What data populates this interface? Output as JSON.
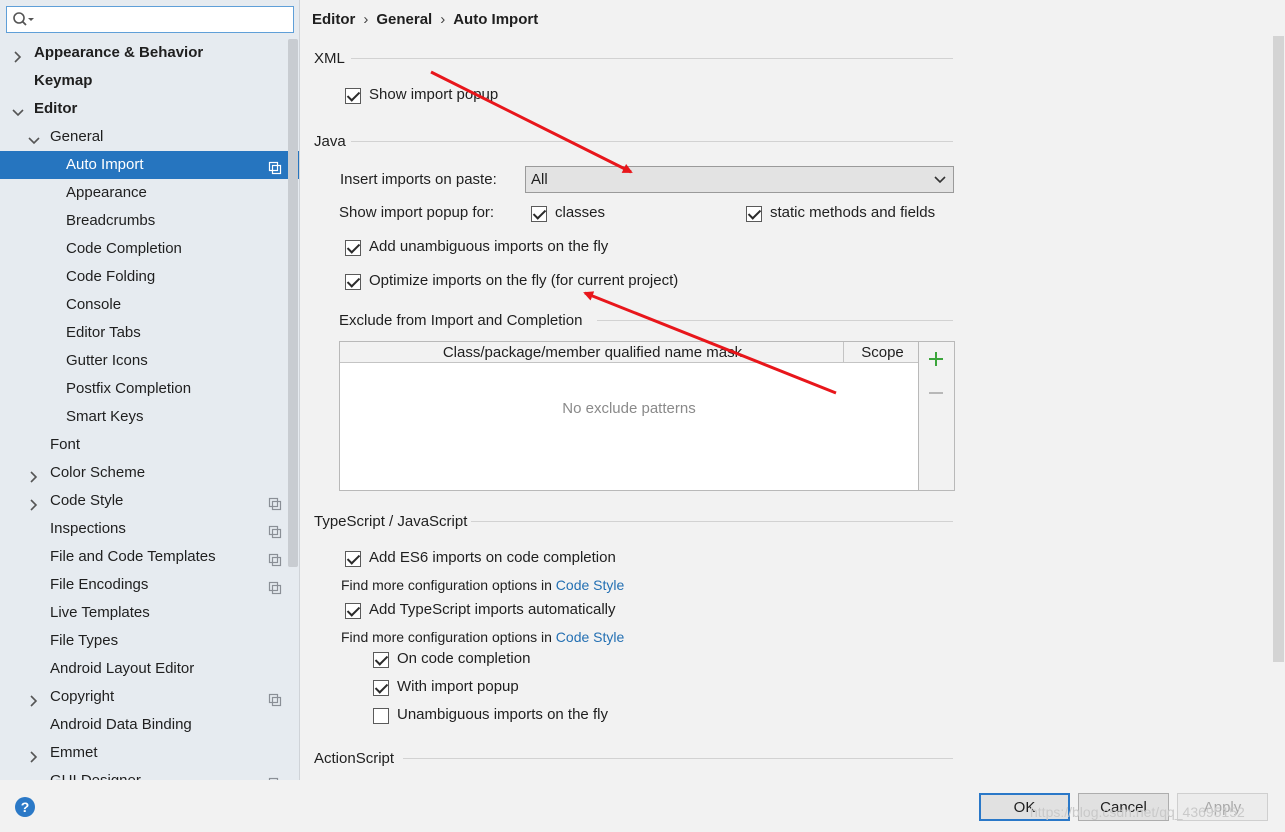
{
  "search": {
    "placeholder": "",
    "value": ""
  },
  "sidebar": {
    "items": [
      {
        "label": "Appearance & Behavior",
        "level": 0,
        "chevron": "right",
        "bold": true,
        "copy": false
      },
      {
        "label": "Keymap",
        "level": 0,
        "chevron": "none",
        "bold": true,
        "copy": false
      },
      {
        "label": "Editor",
        "level": 0,
        "chevron": "down",
        "bold": true,
        "copy": false
      },
      {
        "label": "General",
        "level": 1,
        "chevron": "down",
        "bold": false,
        "copy": false
      },
      {
        "label": "Auto Import",
        "level": 2,
        "chevron": "none",
        "bold": false,
        "copy": true,
        "selected": true
      },
      {
        "label": "Appearance",
        "level": 2,
        "chevron": "none",
        "bold": false,
        "copy": false
      },
      {
        "label": "Breadcrumbs",
        "level": 2,
        "chevron": "none",
        "bold": false,
        "copy": false
      },
      {
        "label": "Code Completion",
        "level": 2,
        "chevron": "none",
        "bold": false,
        "copy": false
      },
      {
        "label": "Code Folding",
        "level": 2,
        "chevron": "none",
        "bold": false,
        "copy": false
      },
      {
        "label": "Console",
        "level": 2,
        "chevron": "none",
        "bold": false,
        "copy": false
      },
      {
        "label": "Editor Tabs",
        "level": 2,
        "chevron": "none",
        "bold": false,
        "copy": false
      },
      {
        "label": "Gutter Icons",
        "level": 2,
        "chevron": "none",
        "bold": false,
        "copy": false
      },
      {
        "label": "Postfix Completion",
        "level": 2,
        "chevron": "none",
        "bold": false,
        "copy": false
      },
      {
        "label": "Smart Keys",
        "level": 2,
        "chevron": "none",
        "bold": false,
        "copy": false
      },
      {
        "label": "Font",
        "level": 1,
        "chevron": "none",
        "bold": false,
        "copy": false
      },
      {
        "label": "Color Scheme",
        "level": 1,
        "chevron": "right",
        "bold": false,
        "copy": false
      },
      {
        "label": "Code Style",
        "level": 1,
        "chevron": "right",
        "bold": false,
        "copy": true
      },
      {
        "label": "Inspections",
        "level": 1,
        "chevron": "none",
        "bold": false,
        "copy": true
      },
      {
        "label": "File and Code Templates",
        "level": 1,
        "chevron": "none",
        "bold": false,
        "copy": true
      },
      {
        "label": "File Encodings",
        "level": 1,
        "chevron": "none",
        "bold": false,
        "copy": true
      },
      {
        "label": "Live Templates",
        "level": 1,
        "chevron": "none",
        "bold": false,
        "copy": false
      },
      {
        "label": "File Types",
        "level": 1,
        "chevron": "none",
        "bold": false,
        "copy": false
      },
      {
        "label": "Android Layout Editor",
        "level": 1,
        "chevron": "none",
        "bold": false,
        "copy": false
      },
      {
        "label": "Copyright",
        "level": 1,
        "chevron": "right",
        "bold": false,
        "copy": true
      },
      {
        "label": "Android Data Binding",
        "level": 1,
        "chevron": "none",
        "bold": false,
        "copy": false
      },
      {
        "label": "Emmet",
        "level": 1,
        "chevron": "right",
        "bold": false,
        "copy": false
      },
      {
        "label": "GUI Designer",
        "level": 1,
        "chevron": "none",
        "bold": false,
        "copy": true
      }
    ]
  },
  "breadcrumb": {
    "part1": "Editor",
    "sep": "›",
    "part2": "General",
    "part3": "Auto Import"
  },
  "xml": {
    "title": "XML",
    "show_import_popup": {
      "label": "Show import popup",
      "checked": true
    }
  },
  "java": {
    "title": "Java",
    "insert_imports_label": "Insert imports on paste:",
    "insert_imports_value": "All",
    "show_popup_for_label": "Show import popup for:",
    "classes": {
      "label": "classes",
      "checked": true
    },
    "static_methods": {
      "label": "static methods and fields",
      "checked": true
    },
    "add_unambiguous": {
      "label": "Add unambiguous imports on the fly",
      "checked": true
    },
    "optimize_imports": {
      "label": "Optimize imports on the fly (for current project)",
      "checked": true
    },
    "exclude_title": "Exclude from Import and Completion",
    "table": {
      "col1": "Class/package/member qualified name mask",
      "col2": "Scope",
      "empty": "No exclude patterns"
    }
  },
  "typescript": {
    "title": "TypeScript / JavaScript",
    "add_es6": {
      "label": "Add ES6 imports on code completion",
      "checked": true
    },
    "find_more_1": "Find more configuration options in",
    "link_1": "Code Style",
    "add_ts": {
      "label": "Add TypeScript imports automatically",
      "checked": true
    },
    "find_more_2": "Find more configuration options in",
    "link_2": "Code Style",
    "on_completion": {
      "label": "On code completion",
      "checked": true
    },
    "with_popup": {
      "label": "With import popup",
      "checked": true
    },
    "unambiguous": {
      "label": "Unambiguous imports on the fly",
      "checked": false
    }
  },
  "actionscript": {
    "title": "ActionScript"
  },
  "footer": {
    "ok": "OK",
    "cancel": "Cancel",
    "apply": "Apply",
    "watermark": "https://blog.csdn.net/qq_43695152"
  },
  "colors": {
    "selection": "#2675bf",
    "link": "#2470b3",
    "annotation_arrow": "#e8161b",
    "add_icon": "#3ba53b"
  },
  "icons": {
    "search": "search-icon",
    "add": "plus-icon",
    "remove": "minus-icon",
    "help": "help-icon",
    "copy": "copy-settings-icon"
  }
}
